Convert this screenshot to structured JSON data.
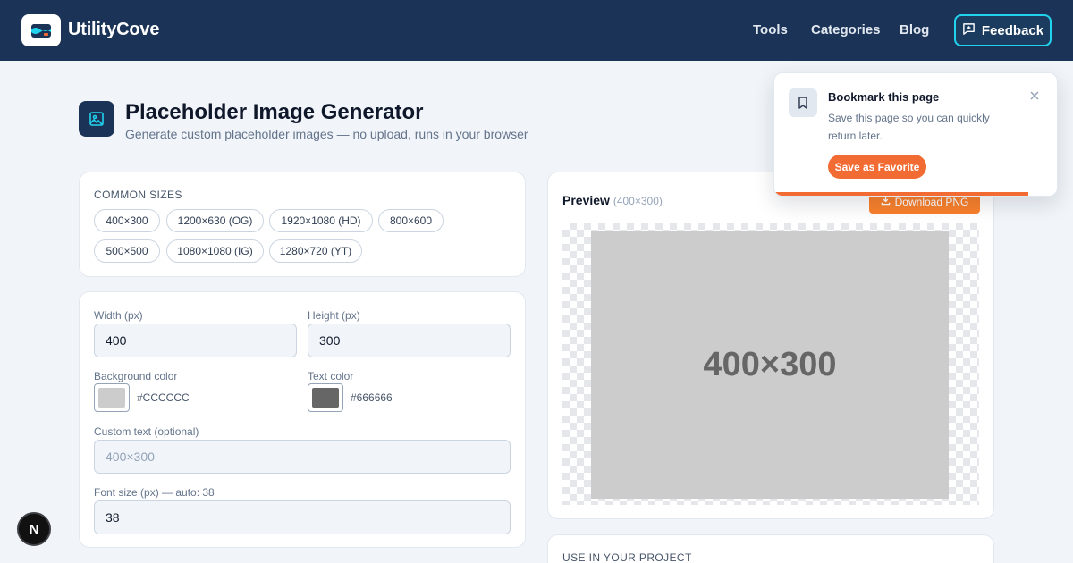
{
  "header": {
    "brand": "UtilityCove",
    "nav": [
      "Tools",
      "Categories",
      "Blog"
    ],
    "feedback_label": "Feedback"
  },
  "page": {
    "title": "Placeholder Image Generator",
    "subtitle": "Generate custom placeholder images — no upload, runs in your browser"
  },
  "sizes": {
    "label": "COMMON SIZES",
    "chips": [
      "400×300",
      "1200×630 (OG)",
      "1920×1080 (HD)",
      "800×600",
      "500×500",
      "1080×1080 (IG)",
      "1280×720 (YT)"
    ]
  },
  "form": {
    "width_label": "Width (px)",
    "width_value": "400",
    "height_label": "Height (px)",
    "height_value": "300",
    "bg_label": "Background color",
    "bg_hex": "#CCCCCC",
    "text_color_label": "Text color",
    "text_hex": "#666666",
    "custom_text_label": "Custom text (optional)",
    "custom_text_placeholder": "400×300",
    "font_size_label": "Font size (px) — auto: 38",
    "font_size_value": "38"
  },
  "preview": {
    "title": "Preview",
    "dimensions": "(400×300)",
    "download_label": "Download PNG",
    "image_text": "400×300"
  },
  "project": {
    "label": "USE IN YOUR PROJECT"
  },
  "bookmark": {
    "title": "Bookmark this page",
    "description": "Save this page so you can quickly return later.",
    "save_label": "Save as Favorite",
    "progress": 0.9
  },
  "next_badge": "N",
  "colors": {
    "header_bg": "#1b3356",
    "accent": "#f26b32",
    "feedback_border": "#22d3ee",
    "placeholder_bg": "#CCCCCC",
    "placeholder_text": "#666666"
  },
  "icons": {
    "logo": "folder-wave-icon",
    "title": "image-icon",
    "feedback": "message-plus-icon",
    "download": "download-icon",
    "bookmark": "bookmark-icon",
    "close": "close-icon"
  }
}
